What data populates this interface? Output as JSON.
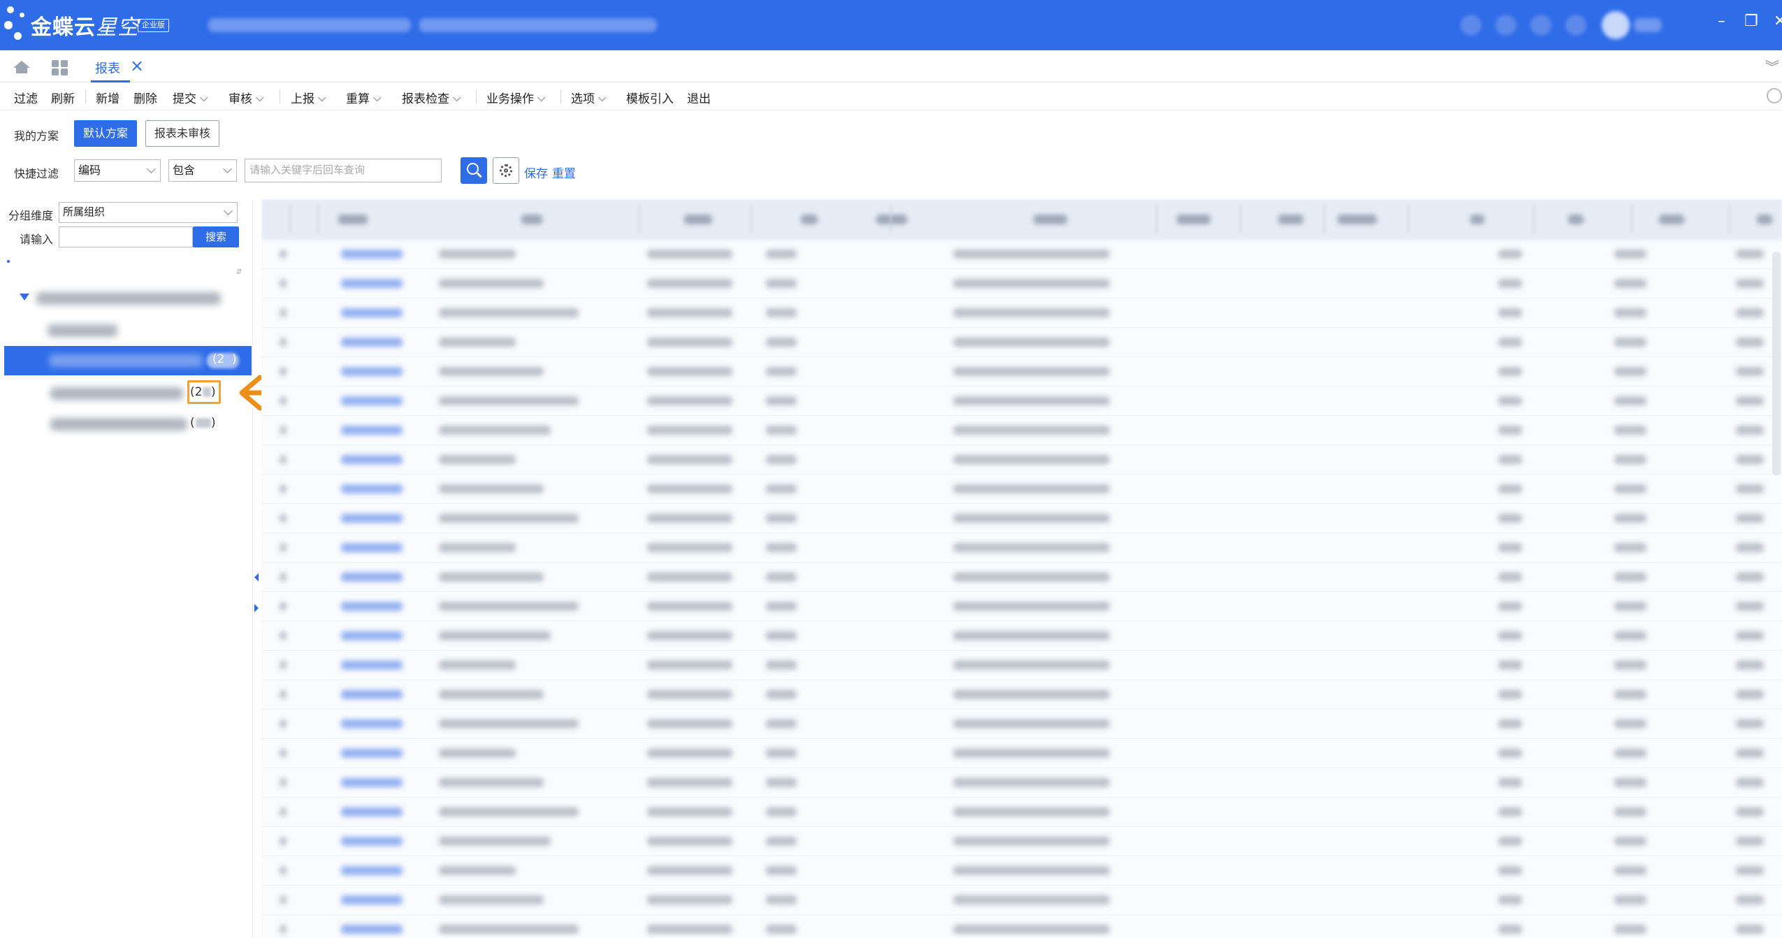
{
  "header": {
    "brand": "金蝶云",
    "brand_suffix": "星空",
    "edition_badge": "企业版"
  },
  "tabs": [
    {
      "label": "报表",
      "active": true
    }
  ],
  "toolbar": {
    "items": [
      {
        "label": "过滤",
        "dropdown": false
      },
      {
        "label": "刷新",
        "dropdown": false
      },
      {
        "label": "新增",
        "dropdown": false
      },
      {
        "label": "删除",
        "dropdown": false
      },
      {
        "label": "提交",
        "dropdown": true
      },
      {
        "label": "审核",
        "dropdown": true
      },
      {
        "label": "上报",
        "dropdown": true
      },
      {
        "label": "重算",
        "dropdown": true
      },
      {
        "label": "报表检查",
        "dropdown": true
      },
      {
        "label": "业务操作",
        "dropdown": true
      },
      {
        "label": "选项",
        "dropdown": true
      },
      {
        "label": "模板引入",
        "dropdown": false
      },
      {
        "label": "退出",
        "dropdown": false
      }
    ]
  },
  "scheme": {
    "label": "我的方案",
    "buttons": [
      {
        "label": "默认方案",
        "active": true
      },
      {
        "label": "报表未审核",
        "active": false
      }
    ]
  },
  "quick_filter": {
    "label": "快捷过滤",
    "field": "编码",
    "operator": "包含",
    "placeholder": "请输入关键字后回车查询",
    "save": "保存",
    "reset": "重置"
  },
  "left_panel": {
    "group_label": "分组维度",
    "group_value": "所属组织",
    "input_label": "请输入",
    "search_button": "搜索",
    "counts": [
      {
        "text": "(2",
        "selected": true,
        "highlighted": false
      },
      {
        "text": "(2",
        "selected": false,
        "highlighted": true
      },
      {
        "text": "(",
        "selected": false,
        "highlighted": false
      }
    ]
  },
  "colors": {
    "brand_blue": "#2f6ce8",
    "highlight_orange": "#f0a23a",
    "selected_row": "#2f6ce8"
  }
}
